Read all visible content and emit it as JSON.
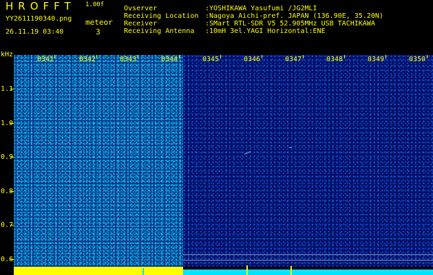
{
  "header": {
    "logo": "HROFFT",
    "version": "1.00f",
    "filename": "YY2611190340.png",
    "datetime": "26.11.19 03:40",
    "meteor_label": "meteor",
    "meteor_count": "3"
  },
  "info": [
    {
      "label": "Ovserver",
      "value": ":YOSHIKAWA Yasufumi /JG2MLI"
    },
    {
      "label": "Receiving Location",
      "value": ":Nagoya Aichi-pref. JAPAN (136.90E, 35.20N)"
    },
    {
      "label": "Receiver",
      "value": ":SMart RTL-SDR V5 52.905MHz USB TACHIKAWA"
    },
    {
      "label": "Receiving Antenna",
      "value": ":10mH 3el.YAGI Horizontal:ENE"
    }
  ],
  "axis": {
    "y_unit": "kHz",
    "y_ticks": [
      "1.1",
      "1.0",
      "0.9",
      "0.8",
      "0.7",
      "0.6"
    ],
    "x_ticks": [
      "0341",
      "0342",
      "0343",
      "0344",
      "0345",
      "0346",
      "0347",
      "0348",
      "0349",
      "0350"
    ]
  },
  "colors": {
    "text": "#ffff00",
    "noise_high": "#0a2f8a",
    "noise_low": "#00106a",
    "signal": "#00e5ff"
  }
}
